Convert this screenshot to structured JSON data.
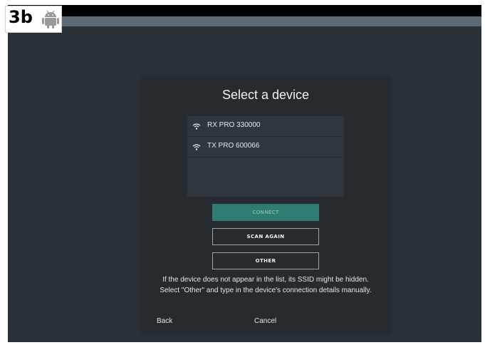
{
  "tag": {
    "label": "3b",
    "icon": "android-icon"
  },
  "dialog": {
    "title": "Select a device",
    "devices": [
      {
        "icon": "wifi-icon",
        "name": "RX PRO 330000"
      },
      {
        "icon": "wifi-icon",
        "name": "TX PRO 600066"
      }
    ],
    "connect_label": "CONNECT",
    "scan_again_label": "SCAN AGAIN",
    "other_label": "OTHER",
    "helper_text": "If the device does not appear in the list, its SSID might be hidden. Select \"Other\" and type in the device's connection details manually.",
    "back_label": "Back",
    "cancel_label": "Cancel"
  },
  "colors": {
    "background": "#2b3237",
    "dialog": "#252b2f",
    "list": "#2f373d",
    "accent": "#2e7d72",
    "header_bar": "#5b6a74"
  }
}
